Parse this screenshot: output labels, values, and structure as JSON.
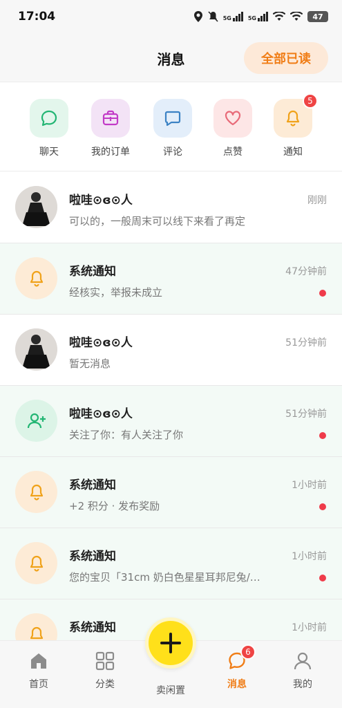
{
  "status_bar": {
    "time": "17:04",
    "signal1": "5G",
    "signal2": "5G",
    "battery": "47"
  },
  "header": {
    "title": "消息",
    "read_all": "全部已读"
  },
  "quick_tabs": [
    {
      "label": "聊天",
      "icon": "chat-icon",
      "bg": "#e3f6ec",
      "color": "#22b573"
    },
    {
      "label": "我的订单",
      "icon": "order-icon",
      "bg": "#f3e3f6",
      "color": "#c23ac7"
    },
    {
      "label": "评论",
      "icon": "comment-icon",
      "bg": "#e3eefa",
      "color": "#3b82c4"
    },
    {
      "label": "点赞",
      "icon": "heart-icon",
      "bg": "#fde6e6",
      "color": "#e86a78"
    },
    {
      "label": "通知",
      "icon": "bell-icon",
      "bg": "#fdebd6",
      "color": "#f0a21a",
      "badge": "5"
    }
  ],
  "messages": [
    {
      "name": "啦哇⊙ɞ⊙人",
      "preview": "可以的，一般周末可以线下来看了再定",
      "time": "刚刚",
      "unread": false,
      "avatar": "photo"
    },
    {
      "name": "系统通知",
      "preview": "经核实，举报未成立",
      "time": "47分钟前",
      "unread": true,
      "avatar": "bell"
    },
    {
      "name": "啦哇⊙ɞ⊙人",
      "preview": "暂无消息",
      "time": "51分钟前",
      "unread": false,
      "avatar": "photo"
    },
    {
      "name": "啦哇⊙ɞ⊙人",
      "preview": "关注了你：有人关注了你",
      "time": "51分钟前",
      "unread": true,
      "avatar": "follow"
    },
    {
      "name": "系统通知",
      "preview": "+2 积分 · 发布奖励",
      "time": "1小时前",
      "unread": true,
      "avatar": "bell"
    },
    {
      "name": "系统通知",
      "preview": "您的宝贝「31cm 奶白色星星耳邦尼兔/…",
      "time": "1小时前",
      "unread": true,
      "avatar": "bell"
    },
    {
      "name": "系统通知",
      "preview": "",
      "time": "1小时前",
      "unread": false,
      "avatar": "bell"
    }
  ],
  "bottom_nav": {
    "home": "首页",
    "category": "分类",
    "sell": "卖闲置",
    "messages": "消息",
    "messages_badge": "6",
    "mine": "我的"
  },
  "colors": {
    "accent": "#f07d16",
    "unread_dot": "#ef3b4a",
    "fab": "#ffe01a"
  }
}
